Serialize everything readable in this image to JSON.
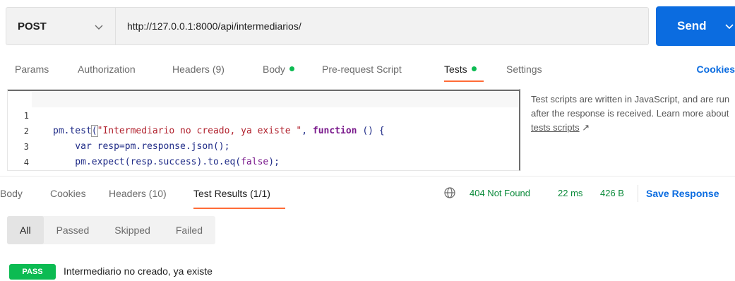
{
  "request": {
    "method": "POST",
    "url": "http://127.0.0.1:8000/api/intermediarios/",
    "send_label": "Send"
  },
  "request_tabs": {
    "params": "Params",
    "authorization": "Authorization",
    "headers": "Headers",
    "headers_count": "(9)",
    "body": "Body",
    "prerequest": "Pre-request Script",
    "tests": "Tests",
    "settings": "Settings",
    "cookies": "Cookies",
    "active": "Tests"
  },
  "editor": {
    "line_numbers": [
      "1",
      "2",
      "3",
      "4"
    ],
    "lines": [
      "pm.test(\"Intermediario no creado, ya existe \", function () {",
      "    var resp=pm.response.json();",
      "    pm.expect(resp.success).to.eq(false);",
      "});"
    ],
    "tokens": {
      "l1_a": "pm.test",
      "l1_b": "(",
      "l1_str": "\"Intermediario no creado, ya existe \"",
      "l1_c": ", ",
      "l1_kw": "function",
      "l1_d": " () {",
      "l2": "    var resp=pm.response.json();",
      "l3_a": "    pm.expect(resp.success).to.eq(",
      "l3_bool": "false",
      "l3_b": ");",
      "l4_a": "}",
      "l4_b": ")",
      "l4_c": ";"
    }
  },
  "help": {
    "text": "Test scripts are written in JavaScript, and are run after the response is received. Learn more about",
    "link": "tests scripts",
    "link_arrow": "↗"
  },
  "response_tabs": {
    "body": "Body",
    "cookies": "Cookies",
    "headers": "Headers (10)",
    "test_results": "Test Results (1/1)",
    "active": "Test Results"
  },
  "response_status": {
    "status": "404 Not Found",
    "time": "22 ms",
    "size": "426 B",
    "save": "Save Response"
  },
  "filters": {
    "items": [
      "All",
      "Passed",
      "Skipped",
      "Failed"
    ],
    "active": "All"
  },
  "results": [
    {
      "status": "PASS",
      "name": "Intermediario no creado, ya existe"
    }
  ],
  "colors": {
    "accent": "#0b6ce0",
    "active_tab_underline": "#ff6c37",
    "pass": "#0cbb52",
    "status_ok_text": "#0a8a3a"
  }
}
